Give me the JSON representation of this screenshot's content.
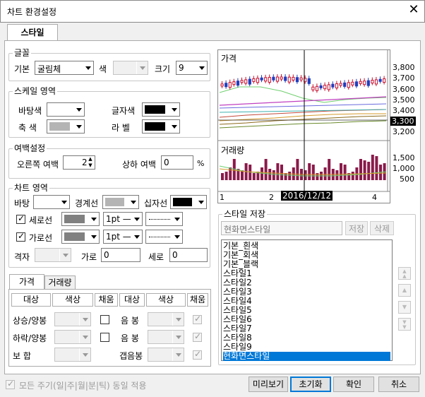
{
  "window": {
    "title": "차트 환경설정",
    "close_glyph": "✕"
  },
  "tabs": {
    "main": "스타일"
  },
  "font": {
    "legend": "글꼴",
    "base_label": "기본",
    "font_value": "굴림체",
    "color_label": "색",
    "size_label": "크기",
    "size_value": "9"
  },
  "scale": {
    "legend": "스케일 영역",
    "bg_label": "바탕색",
    "text_color_label": "글자색",
    "axis_label": "축  색",
    "label_label": "라  벨",
    "colors": {
      "bg": "#ffffff",
      "text": "#000000",
      "axis": "#b4b4b4",
      "label": "#000000"
    }
  },
  "margin": {
    "legend": "여백설정",
    "right_label": "오른쪽 여백",
    "right_value": "2",
    "updown_label": "상하 여백",
    "updown_value": "0",
    "unit": "%"
  },
  "chart_area": {
    "legend": "차트 영역",
    "bg_label": "바탕",
    "border_label": "경계선",
    "cross_label": "십자선",
    "vline_label": "세로선",
    "vline_width": "1pt —",
    "hline_label": "가로선",
    "hline_width": "1pt —",
    "grid_label": "격자",
    "horiz_label": "가로",
    "horiz_value": "0",
    "vert_label": "세로",
    "vert_value": "0",
    "colors": {
      "bg": "#ffffff",
      "border": "#b4b4b4",
      "cross": "#000000",
      "vline": "#808080",
      "hline": "#808080"
    }
  },
  "subtabs": {
    "price": "가격",
    "volume": "거래량"
  },
  "price_table": {
    "headers": [
      "대상",
      "색상",
      "채움",
      "대상",
      "색상",
      "채움"
    ],
    "rows": [
      {
        "left": "상승/양봉",
        "right": "음  봉"
      },
      {
        "left": "하락/양봉",
        "right": "음  봉"
      },
      {
        "left": "보    합",
        "right": "갭음봉"
      }
    ]
  },
  "preview": {
    "price_title": "가격",
    "volume_title": "거래량",
    "price_ticks": [
      "3,800",
      "3,700",
      "3,600",
      "3,500",
      "3,400",
      "3,300",
      "3,200"
    ],
    "current_price": "3,300",
    "volume_ticks": [
      "1,500",
      "1,000",
      "500"
    ],
    "x_labels": [
      "1",
      "2",
      "4"
    ],
    "cursor_date": "2016/12/12"
  },
  "style_save": {
    "legend": "스타일 저장",
    "name_value": "현화면스타일",
    "save_btn": "저장",
    "delete_btn": "삭제",
    "items": [
      "기본_흰색",
      "기본_회색",
      "기본_블랙",
      "스타일1",
      "스타일2",
      "스타일3",
      "스타일4",
      "스타일5",
      "스타일6",
      "스타일7",
      "스타일8",
      "스타일9",
      "현화면스타일"
    ],
    "selected_index": 12,
    "side_icons": [
      "▲▲",
      "▲",
      "▼",
      "▼▼"
    ]
  },
  "footer": {
    "apply_all_label": "모든 주기(일|주|월|분|틱) 동일 적용",
    "preview_btn": "미리보기",
    "reset_btn": "초기화",
    "ok_btn": "확인",
    "cancel_btn": "취소"
  }
}
